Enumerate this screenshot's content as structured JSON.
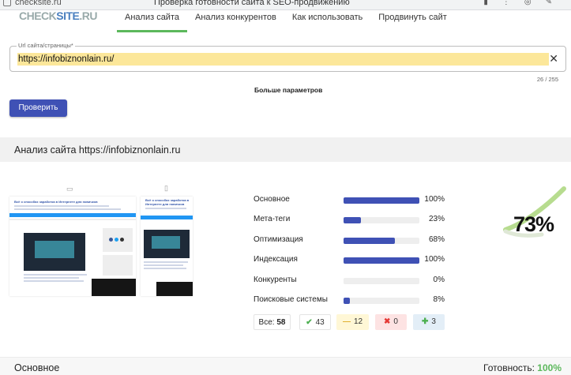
{
  "browser": {
    "url": "checksite.ru",
    "page_title": "Проверка готовности сайта к SEO-продвижению"
  },
  "logo": {
    "part1": "CHECK",
    "part2": "SITE",
    "part3": ".RU"
  },
  "nav": {
    "items": [
      "Анализ сайта",
      "Анализ конкурентов",
      "Как использовать",
      "Продвинуть сайт"
    ],
    "active_index": 0
  },
  "url_field": {
    "label": "Url сайта/страницы*",
    "value": "https://infobiznonlain.ru/",
    "counter": "26 / 255"
  },
  "more_params": "Больше параметров",
  "check_button": "Проверить",
  "analysis_title": "Анализ сайта https://infobiznonlain.ru",
  "screenshot": {
    "site_title": "Всё о способах заработка в Интернете для новичков"
  },
  "metrics": [
    {
      "name": "Основное",
      "value": 100,
      "label": "100%"
    },
    {
      "name": "Мета-теги",
      "value": 23,
      "label": "23%"
    },
    {
      "name": "Оптимизация",
      "value": 68,
      "label": "68%"
    },
    {
      "name": "Индексация",
      "value": 100,
      "label": "100%"
    },
    {
      "name": "Конкуренты",
      "value": 0,
      "label": "0%"
    },
    {
      "name": "Поисковые системы",
      "value": 8,
      "label": "8%"
    }
  ],
  "summary": {
    "total_label": "Все:",
    "total_value": "58",
    "ok": "43",
    "warnings": "12",
    "errors": "0",
    "plus": "3"
  },
  "score": {
    "label": "73%",
    "value": 73
  },
  "bottom": {
    "section": "Основное",
    "readiness_label": "Готовность:",
    "readiness_value": "100%"
  },
  "colors": {
    "accent": "#3f51b5",
    "nav_active": "#5cb85c",
    "url_highlight": "#fce79a",
    "gauge": "#8bc34a"
  }
}
